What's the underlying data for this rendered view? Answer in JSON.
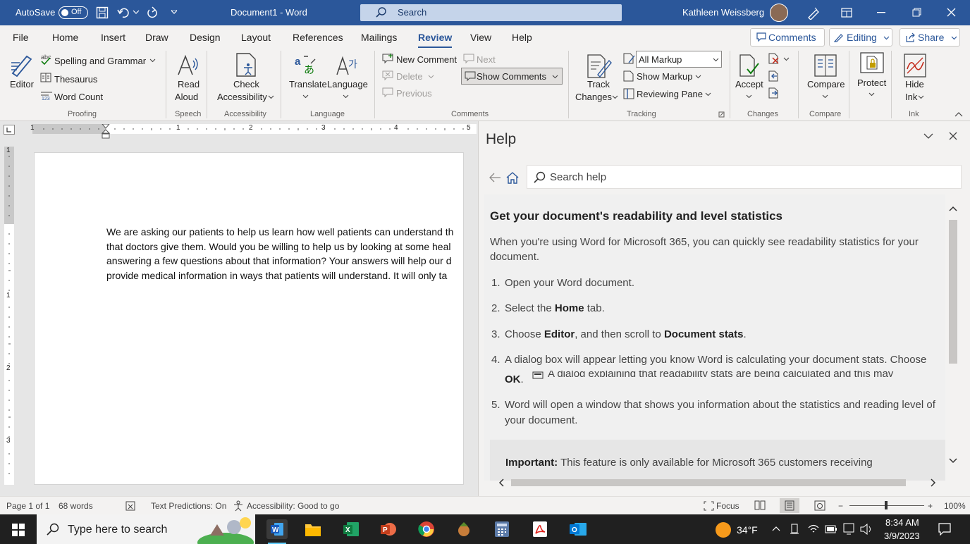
{
  "titlebar": {
    "autosave_label": "AutoSave",
    "autosave_state": "Off",
    "doc_title": "Document1  -  Word",
    "search_placeholder": "Search",
    "user_name": "Kathleen Weissberg"
  },
  "menu": {
    "tabs": [
      "File",
      "Home",
      "Insert",
      "Draw",
      "Design",
      "Layout",
      "References",
      "Mailings",
      "Review",
      "View",
      "Help"
    ],
    "active": "Review",
    "comments_btn": "Comments",
    "editing_btn": "Editing",
    "share_btn": "Share"
  },
  "ribbon": {
    "proofing": {
      "editor": "Editor",
      "spelling": "Spelling and Grammar",
      "thesaurus": "Thesaurus",
      "wordcount": "Word Count",
      "group": "Proofing"
    },
    "speech": {
      "read_aloud_1": "Read",
      "read_aloud_2": "Aloud",
      "group": "Speech"
    },
    "accessibility": {
      "check_1": "Check",
      "check_2": "Accessibility",
      "group": "Accessibility"
    },
    "language": {
      "translate": "Translate",
      "language": "Language",
      "group": "Language"
    },
    "comments": {
      "new": "New Comment",
      "next": "Next",
      "delete": "Delete",
      "show": "Show Comments",
      "previous": "Previous",
      "group": "Comments"
    },
    "tracking": {
      "track_1": "Track",
      "track_2": "Changes",
      "markup_value": "All Markup",
      "show_markup": "Show Markup",
      "reviewing_pane": "Reviewing Pane",
      "group": "Tracking"
    },
    "changes": {
      "accept": "Accept",
      "group": "Changes"
    },
    "compare": {
      "compare": "Compare",
      "group": "Compare"
    },
    "protect": {
      "protect": "Protect"
    },
    "ink": {
      "hide_1": "Hide",
      "hide_2": "Ink",
      "group": "Ink"
    }
  },
  "ruler": {
    "h_marks": [
      "1",
      "1",
      "2",
      "3",
      "4",
      "5"
    ],
    "v_marks": [
      "1",
      "1",
      "2",
      "3"
    ]
  },
  "document": {
    "lines": [
      "We are asking our patients to help us learn how well patients can understand th",
      "that doctors give them. Would you be willing to help us by looking at some heal",
      "answering a few questions about that information? Your answers will help our d",
      "provide medical information in ways that patients will understand. It will only ta"
    ]
  },
  "help": {
    "title": "Help",
    "search_placeholder": "Search help",
    "heading": "Get your document's readability and level statistics",
    "intro_1": "When you're using Word for Microsoft 365, you can quickly see readability statistics for your",
    "intro_2": "document.",
    "steps": {
      "s1_num": "1.",
      "s1": "Open your Word document.",
      "s2_num": "2.",
      "s2_a": "Select the ",
      "s2_b": "Home",
      "s2_c": " tab.",
      "s3_num": "3.",
      "s3_a": "Choose ",
      "s3_b": "Editor",
      "s3_c": ", and then scroll to ",
      "s3_d": "Document stats",
      "s3_e": ".",
      "s4_num": "4.",
      "s4_a": "A dialog box will appear letting you know Word is calculating your document stats. Choose",
      "s4_b": "OK",
      "s4_c": ".",
      "s4_img": "A dialog explaining that readability stats are being calculated and this may",
      "s5_num": "5.",
      "s5_a": "Word will open a window that shows you information about the statistics and reading level of",
      "s5_b": "your document."
    },
    "important_label": "Important:",
    "important_text": " This feature is only available for Microsoft 365 customers receiving"
  },
  "status": {
    "page": "Page 1 of 1",
    "words": "68 words",
    "predictions": "Text Predictions: On",
    "accessibility": "Accessibility: Good to go",
    "focus": "Focus",
    "zoom_minus": "−",
    "zoom_plus": "+",
    "zoom": "100%"
  },
  "taskbar": {
    "search_placeholder": "Type here to search",
    "weather": "34°F",
    "time": "8:34 AM",
    "date": "3/9/2023"
  },
  "colors": {
    "word_blue": "#2b579a",
    "ribbon_bg": "#f3f2f1",
    "taskbar": "#202020"
  }
}
